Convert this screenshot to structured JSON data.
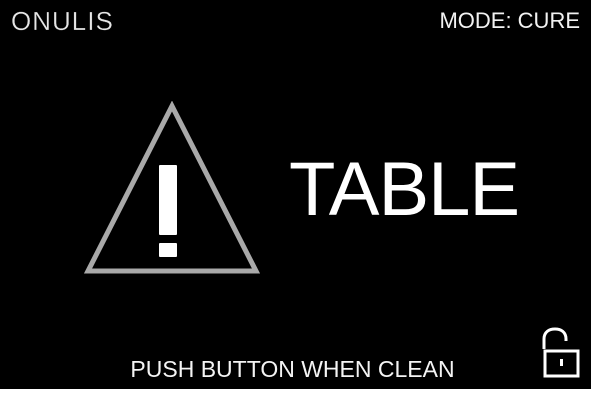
{
  "header": {
    "brand": "ONULIS",
    "mode": "MODE: CURE"
  },
  "main": {
    "warning_icon": "warning-triangle-icon",
    "headline": "TABLE"
  },
  "footer": {
    "instruction": "PUSH BUTTON WHEN CLEAN",
    "lock_icon": "unlocked-padlock-icon"
  },
  "colors": {
    "background": "#000000",
    "text": "#ffffff",
    "warning_icon": "#b0b0b0"
  }
}
